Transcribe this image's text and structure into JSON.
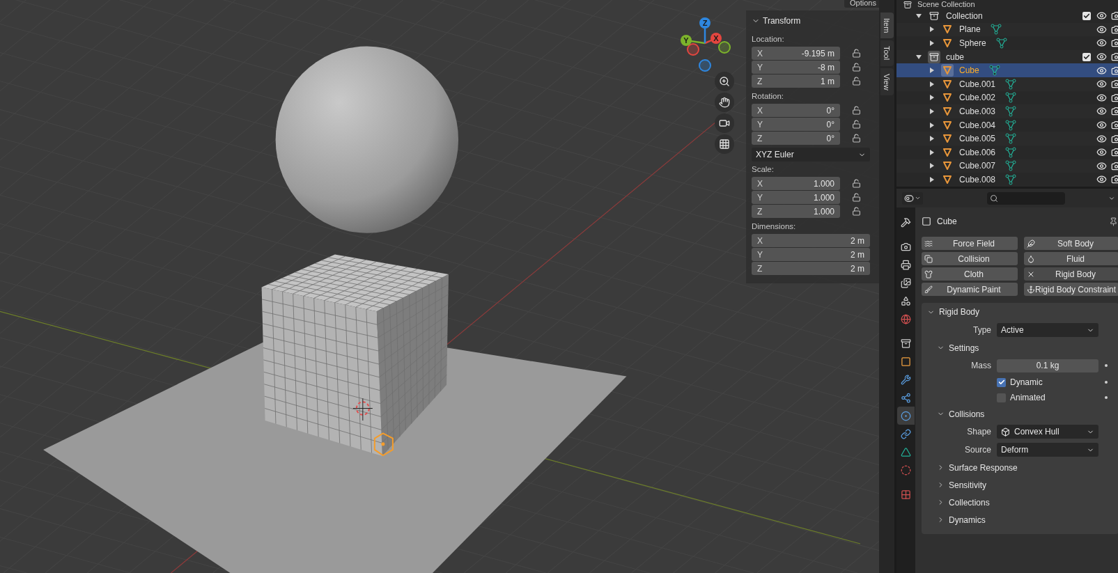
{
  "viewport": {
    "header_button": "Options",
    "gizmo_axes": [
      {
        "label": "X",
        "color": "#e4463f"
      },
      {
        "label": "Y",
        "color": "#7cb32b"
      },
      {
        "label": "Z",
        "color": "#2e87e0"
      }
    ],
    "sidebar_tabs": [
      {
        "label": "Item",
        "selected": true
      },
      {
        "label": "Tool",
        "selected": false
      },
      {
        "label": "View",
        "selected": false
      }
    ],
    "transform": {
      "title": "Transform",
      "expanded": true,
      "groups": [
        {
          "kind": "vector",
          "label": "Location:",
          "lockable": true,
          "fields": [
            {
              "axis": "X",
              "value": "-9.195 m"
            },
            {
              "axis": "Y",
              "value": "-8 m"
            },
            {
              "axis": "Z",
              "value": "1 m"
            }
          ]
        },
        {
          "kind": "vector",
          "label": "Rotation:",
          "lockable": true,
          "fields": [
            {
              "axis": "X",
              "value": "0°"
            },
            {
              "axis": "Y",
              "value": "0°"
            },
            {
              "axis": "Z",
              "value": "0°"
            }
          ]
        },
        {
          "kind": "dropdown",
          "value": "XYZ Euler"
        },
        {
          "kind": "vector",
          "label": "Scale:",
          "lockable": true,
          "fields": [
            {
              "axis": "X",
              "value": "1.000"
            },
            {
              "axis": "Y",
              "value": "1.000"
            },
            {
              "axis": "Z",
              "value": "1.000"
            }
          ]
        },
        {
          "kind": "vector",
          "label": "Dimensions:",
          "lockable": false,
          "fields": [
            {
              "axis": "X",
              "value": "2 m"
            },
            {
              "axis": "Y",
              "value": "2 m"
            },
            {
              "axis": "Z",
              "value": "2 m"
            }
          ]
        }
      ]
    }
  },
  "outliner": {
    "root": "Scene Collection",
    "items": [
      {
        "name": "Collection",
        "kind": "collection",
        "expanded": true,
        "checked": true,
        "active": false,
        "selected": false,
        "children": [
          {
            "name": "Plane",
            "kind": "mesh",
            "expanded": false,
            "selected": false
          },
          {
            "name": "Sphere",
            "kind": "mesh",
            "expanded": false,
            "selected": false
          }
        ]
      },
      {
        "name": "cube",
        "kind": "collection",
        "expanded": true,
        "checked": true,
        "active": true,
        "selected": false,
        "children": [
          {
            "name": "Cube",
            "kind": "mesh",
            "expanded": false,
            "selected": true
          },
          {
            "name": "Cube.001",
            "kind": "mesh",
            "expanded": false,
            "selected": false
          },
          {
            "name": "Cube.002",
            "kind": "mesh",
            "expanded": false,
            "selected": false
          },
          {
            "name": "Cube.003",
            "kind": "mesh",
            "expanded": false,
            "selected": false
          },
          {
            "name": "Cube.004",
            "kind": "mesh",
            "expanded": false,
            "selected": false
          },
          {
            "name": "Cube.005",
            "kind": "mesh",
            "expanded": false,
            "selected": false
          },
          {
            "name": "Cube.006",
            "kind": "mesh",
            "expanded": false,
            "selected": false
          },
          {
            "name": "Cube.007",
            "kind": "mesh",
            "expanded": false,
            "selected": false
          },
          {
            "name": "Cube.008",
            "kind": "mesh",
            "expanded": false,
            "selected": false
          }
        ]
      }
    ]
  },
  "properties": {
    "tabs": [
      {
        "selected": false
      },
      {
        "selected": false
      },
      {
        "selected": false
      },
      {
        "selected": false
      },
      {
        "selected": false
      },
      {
        "selected": false
      },
      {
        "selected": false
      },
      {
        "selected": false
      },
      {
        "selected": false
      },
      {
        "selected": false
      },
      {
        "selected": true
      },
      {
        "selected": false
      },
      {
        "selected": false
      },
      {
        "selected": false
      },
      {
        "selected": false
      }
    ],
    "object_name": "Cube",
    "physics_buttons": [
      {
        "label": "Force Field",
        "enabled": false
      },
      {
        "label": "Soft Body",
        "enabled": false
      },
      {
        "label": "Collision",
        "enabled": false
      },
      {
        "label": "Fluid",
        "enabled": false
      },
      {
        "label": "Cloth",
        "enabled": false
      },
      {
        "label": "Rigid Body",
        "enabled": true
      },
      {
        "label": "Dynamic Paint",
        "enabled": false
      },
      {
        "label": "Rigid Body Constraint",
        "enabled": false
      }
    ],
    "rigid_body": {
      "title": "Rigid Body",
      "expanded": true,
      "rows": [
        {
          "kind": "dropdown",
          "label": "Type",
          "value": "Active"
        }
      ],
      "subpanels": [
        {
          "title": "Settings",
          "expanded": true,
          "rows": [
            {
              "kind": "number",
              "label": "Mass",
              "value": "0.1 kg"
            },
            {
              "kind": "checkbox",
              "label": "Dynamic",
              "checked": true
            },
            {
              "kind": "checkbox",
              "label": "Animated",
              "checked": false
            }
          ]
        },
        {
          "title": "Collisions",
          "expanded": true,
          "rows": [
            {
              "kind": "shape_dropdown",
              "label": "Shape",
              "value": "Convex Hull"
            },
            {
              "kind": "dropdown",
              "label": "Source",
              "value": "Deform"
            }
          ]
        },
        {
          "title": "Surface Response",
          "expanded": false
        },
        {
          "title": "Sensitivity",
          "expanded": false
        },
        {
          "title": "Collections",
          "expanded": false
        },
        {
          "title": "Dynamics",
          "expanded": false
        }
      ]
    }
  }
}
